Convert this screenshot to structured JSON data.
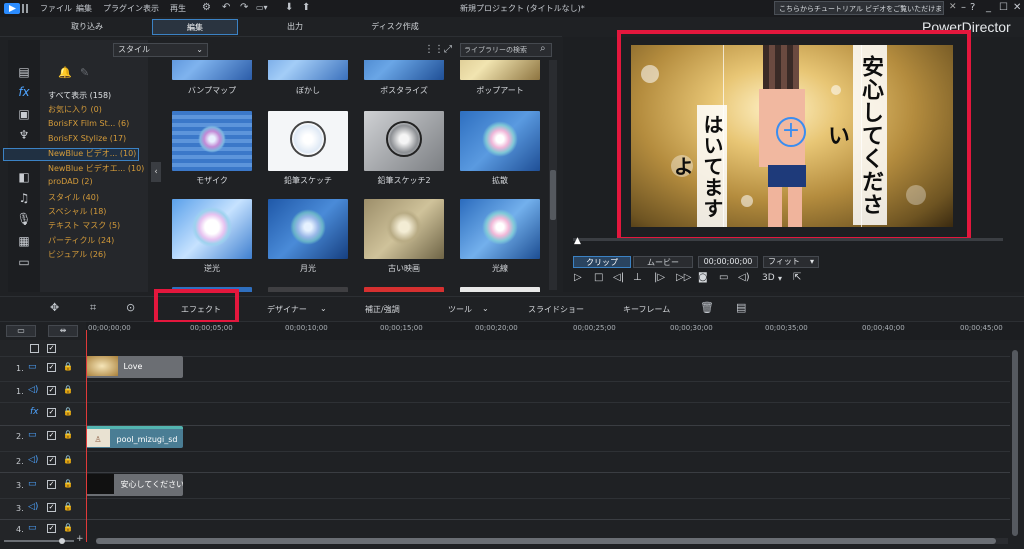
{
  "menu": {
    "items": [
      "ファイル",
      "編集",
      "プラグイン",
      "表示",
      "再生"
    ],
    "project_title": "新規プロジェクト (タイトルなし)*",
    "tutorial": "こちらからチュートリアル ビデオをご覧いただけます。",
    "help": "?"
  },
  "modes": {
    "capture": "取り込み",
    "edit": "編集",
    "output": "出力",
    "disc": "ディスク作成"
  },
  "brand": "PowerDirector",
  "library": {
    "style_select": "スタイル",
    "search_placeholder": "ライブラリーの検索",
    "categories": [
      {
        "label": "すべて表示 (158)"
      },
      {
        "label": "お気に入り (0)"
      },
      {
        "label": "BorisFX Film St... (6)"
      },
      {
        "label": "BorisFX Stylize (17)"
      },
      {
        "label": "NewBlue ビデオ... (10)"
      },
      {
        "label": "NewBlue ビデオエ... (10)"
      },
      {
        "label": "proDAD (2)"
      },
      {
        "label": "スタイル (40)"
      },
      {
        "label": "スペシャル (18)"
      },
      {
        "label": "テキスト マスク (5)"
      },
      {
        "label": "パーティクル (24)"
      },
      {
        "label": "ビジュアル (26)"
      }
    ],
    "effects": [
      {
        "label": "バンプマップ"
      },
      {
        "label": "ぼかし"
      },
      {
        "label": "ポスタライズ"
      },
      {
        "label": "ポップアート"
      },
      {
        "label": "モザイク"
      },
      {
        "label": "鉛筆スケッチ"
      },
      {
        "label": "鉛筆スケッチ2"
      },
      {
        "label": "拡散"
      },
      {
        "label": "逆光"
      },
      {
        "label": "月光"
      },
      {
        "label": "古い映画"
      },
      {
        "label": "光線"
      }
    ]
  },
  "preview": {
    "text_right": "安心してください",
    "text_left": "はいてますよ",
    "tab_clip": "クリップ",
    "tab_movie": "ムービー",
    "timecode": "00;00;00;00",
    "fit": "フィット",
    "mode_3d": "3D"
  },
  "timeline_toolbar": {
    "effect": "エフェクト",
    "designer": "デザイナー",
    "correct": "補正/強調",
    "tools": "ツール",
    "slideshow": "スライドショー",
    "keyframe": "キーフレーム"
  },
  "ruler": [
    "00;00;00;00",
    "00;00;05;00",
    "00;00;10;00",
    "00;00;15;00",
    "00;00;20;00",
    "00;00;25;00",
    "00;00;30;00",
    "00;00;35;00",
    "00;00;40;00",
    "00;00;45;00"
  ],
  "tracks": [
    {
      "num": "1."
    },
    {
      "num": "1."
    },
    {
      "num": "2."
    },
    {
      "num": "2."
    },
    {
      "num": "3."
    },
    {
      "num": "3."
    },
    {
      "num": "4."
    }
  ],
  "clips": {
    "love": "Love",
    "pool": "pool_mizugi_sd",
    "title": "安心してください"
  },
  "colors": {
    "accent": "#3b82c4",
    "highlight": "#e3173d",
    "category": "#d49b3a"
  }
}
